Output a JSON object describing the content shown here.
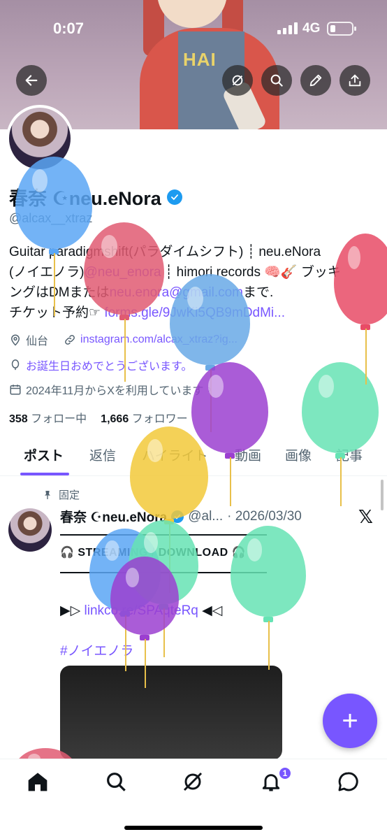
{
  "status_bar": {
    "time": "0:07",
    "network": "4G"
  },
  "profile": {
    "name": "春奈 ☪neu.eNora",
    "handle": "@alcax__xtraz",
    "bio_line1": "Guitar paradigmshift(パラダイムシフト) ┊ neu.eNora",
    "bio_line2a": "(ノイエノラ)",
    "bio_line2_link": "@neu_enora",
    "bio_line2b": " ┊ himori records 🧠🎸 ブッキ",
    "bio_line3a": "ングはDMまたは",
    "bio_line3_link": "neu.enora@gmail.com",
    "bio_line3b": "まで.",
    "bio_line4a": "チケット予約☞ ",
    "bio_line4_link": "forms.gle/9JwKi5QB9mDdMi...",
    "location": "仙台",
    "website": "instagram.com/alcax_xtraz?ig...",
    "birthday": "お誕生日おめでとうございます。",
    "joined": "2024年11月からXを利用しています",
    "following_count": "358",
    "following_label": "フォロー中",
    "followers_count": "1,666",
    "followers_label": "フォロワー"
  },
  "tabs": [
    "ポスト",
    "返信",
    "ハイライト",
    "動画",
    "画像",
    "記事"
  ],
  "post": {
    "pinned_label": "固定",
    "name": "春奈 ☪neu.eNora",
    "handle": "@al...",
    "date": "· 2026/03/30",
    "stream": "🎧 STREAMING / DOWNLOAD 🎧",
    "link_prefix": "▶▷ ",
    "link": "linkco.re/SPAqteRq",
    "link_suffix": " ◀◁",
    "hashtag": "#ノイエノラ"
  },
  "fab_label": "+",
  "notifications_badge": "1",
  "colors": {
    "accent": "#7856ff",
    "verified": "#1d9bf0"
  },
  "icons": {
    "back": "arrow-left-icon",
    "grok": "grok-icon",
    "search": "search-icon",
    "edit": "pencil-icon",
    "share": "share-icon"
  }
}
